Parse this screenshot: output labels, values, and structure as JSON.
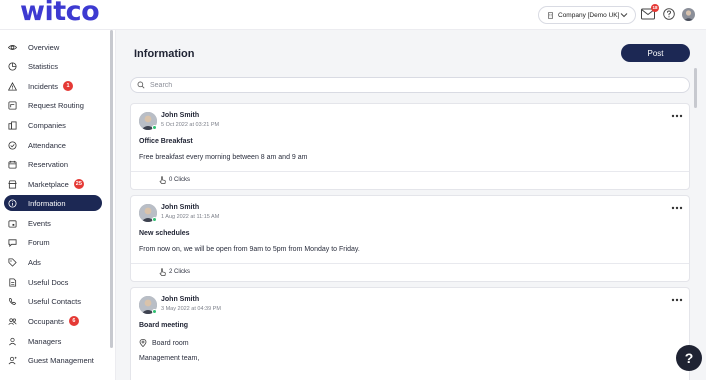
{
  "app": {
    "logo": "witco"
  },
  "topbar": {
    "company": "Company [Demo UK]",
    "mail_badge": "18"
  },
  "sidebar": {
    "items": [
      {
        "label": "Overview",
        "icon": "eye-icon"
      },
      {
        "label": "Statistics",
        "icon": "pie-chart-icon"
      },
      {
        "label": "Incidents",
        "icon": "warning-icon",
        "badge": "1"
      },
      {
        "label": "Request Routing",
        "icon": "route-icon"
      },
      {
        "label": "Companies",
        "icon": "building-icon"
      },
      {
        "label": "Attendance",
        "icon": "check-circle-icon"
      },
      {
        "label": "Reservation",
        "icon": "calendar-icon"
      },
      {
        "label": "Marketplace",
        "icon": "store-icon",
        "badge": "25"
      },
      {
        "label": "Information",
        "icon": "info-icon",
        "active": true
      },
      {
        "label": "Events",
        "icon": "event-icon"
      },
      {
        "label": "Forum",
        "icon": "chat-icon"
      },
      {
        "label": "Ads",
        "icon": "tag-icon"
      },
      {
        "label": "Useful Docs",
        "icon": "document-icon"
      },
      {
        "label": "Useful Contacts",
        "icon": "contact-icon"
      },
      {
        "label": "Occupants",
        "icon": "users-icon",
        "badge": "6"
      },
      {
        "label": "Managers",
        "icon": "user-icon"
      },
      {
        "label": "Guest Management",
        "icon": "guest-icon"
      }
    ]
  },
  "main": {
    "title": "Information",
    "post_button": "Post",
    "search_placeholder": "Search",
    "posts": [
      {
        "author": "John Smith",
        "date": "5 Oct 2022 at 03:21 PM",
        "title": "Office Breakfast",
        "body": "Free breakfast every morning between 8 am and 9 am",
        "clicks": "0 Clicks"
      },
      {
        "author": "John Smith",
        "date": "1 Aug 2022 at 11:15 AM",
        "title": "New schedules",
        "body": "From now on, we will be open from 9am to 5pm from Monday to Friday.",
        "clicks": "2 Clicks"
      },
      {
        "author": "John Smith",
        "date": "3 May 2022 at 04:39 PM",
        "title": "Board meeting",
        "location": "Board room",
        "body": "Management team,"
      }
    ]
  },
  "help_fab": "?",
  "colors": {
    "brand": "#3d3ad1",
    "navy": "#1c2854",
    "badge": "#e53935",
    "online": "#2fbf71"
  }
}
